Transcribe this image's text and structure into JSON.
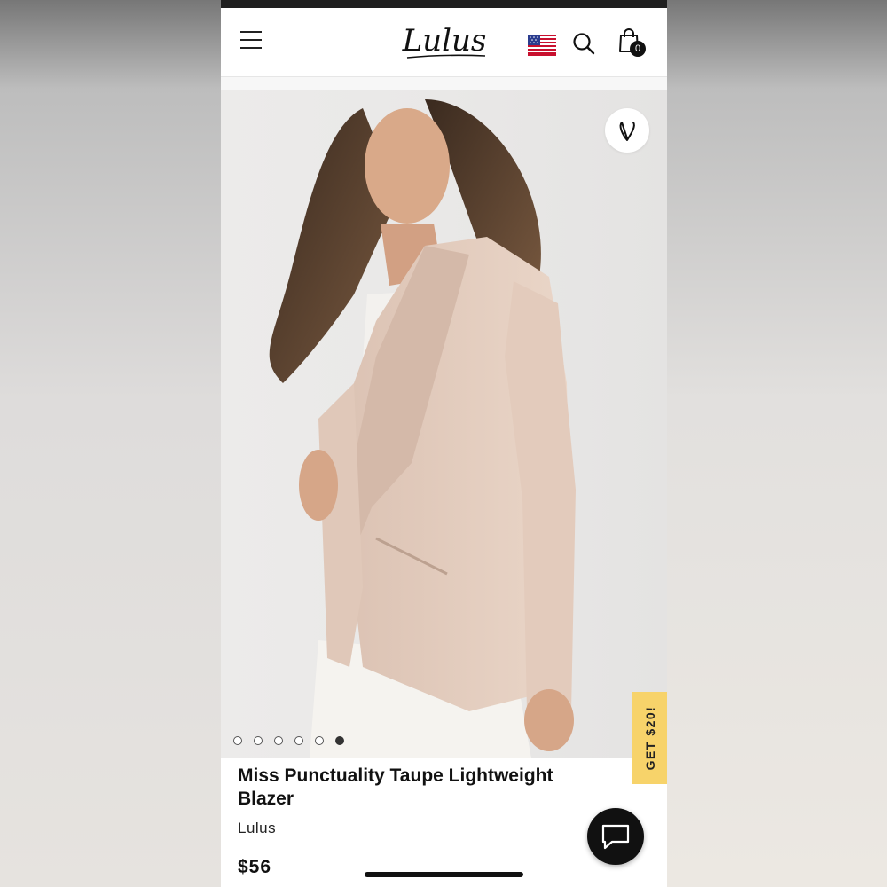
{
  "header": {
    "logo_text": "Lulus",
    "cart_count": "0",
    "icons": [
      "menu-icon",
      "us-flag-icon",
      "search-icon",
      "shopping-bag-icon"
    ]
  },
  "gallery": {
    "image_alt": "Model wearing taupe lightweight blazer over white top",
    "dots_total": 6,
    "active_dot_index": 5,
    "favorite_icon": "heart-icon"
  },
  "promo": {
    "tab_label": "GET $20!",
    "color": "#f7d36a"
  },
  "product": {
    "title": "Miss Punctuality Taupe Lightweight Blazer",
    "brand": "Lulus",
    "price": "$56"
  },
  "chat": {
    "icon": "chat-bubble-icon"
  }
}
